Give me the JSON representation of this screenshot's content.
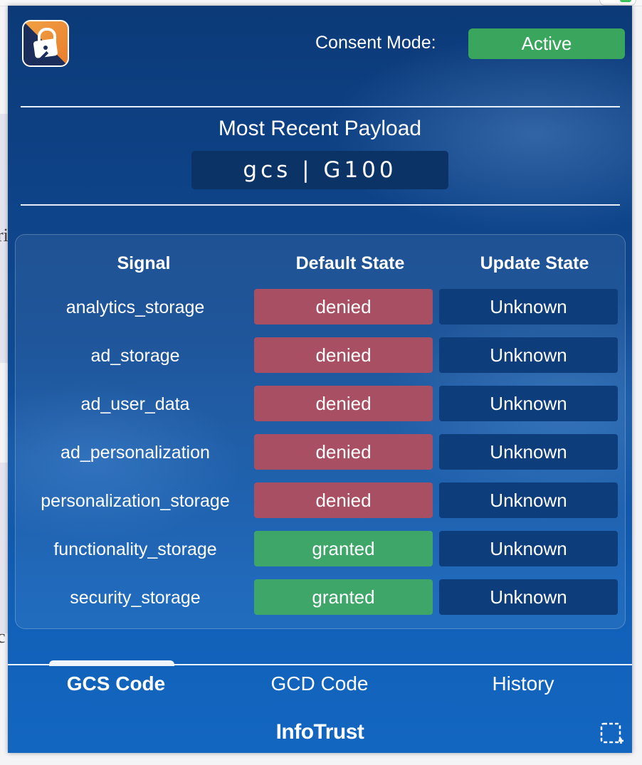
{
  "background_fragments": {
    "left_text_1": "ri",
    "left_text_2": "c"
  },
  "header": {
    "logo": "lock-shield-logo",
    "consent_label": "Consent Mode:",
    "consent_status": "Active",
    "consent_status_color": "#3aa55d"
  },
  "payload": {
    "title": "Most Recent Payload",
    "value": "gcs | G100"
  },
  "table": {
    "headers": {
      "signal": "Signal",
      "default": "Default State",
      "update": "Update State"
    },
    "rows": [
      {
        "signal": "analytics_storage",
        "default": "denied",
        "update": "Unknown"
      },
      {
        "signal": "ad_storage",
        "default": "denied",
        "update": "Unknown"
      },
      {
        "signal": "ad_user_data",
        "default": "denied",
        "update": "Unknown"
      },
      {
        "signal": "ad_personalization",
        "default": "denied",
        "update": "Unknown"
      },
      {
        "signal": "personalization_storage",
        "default": "denied",
        "update": "Unknown"
      },
      {
        "signal": "functionality_storage",
        "default": "granted",
        "update": "Unknown"
      },
      {
        "signal": "security_storage",
        "default": "granted",
        "update": "Unknown"
      }
    ],
    "colors": {
      "denied": "#a94f63",
      "granted": "#3fa66a",
      "unknown": "#0d3d7a"
    }
  },
  "tabs": [
    {
      "label": "GCS Code",
      "active": true
    },
    {
      "label": "GCD Code",
      "active": false
    },
    {
      "label": "History",
      "active": false
    }
  ],
  "footer": {
    "brand": "InfoTrust",
    "select_icon": "dashed-select-icon"
  }
}
